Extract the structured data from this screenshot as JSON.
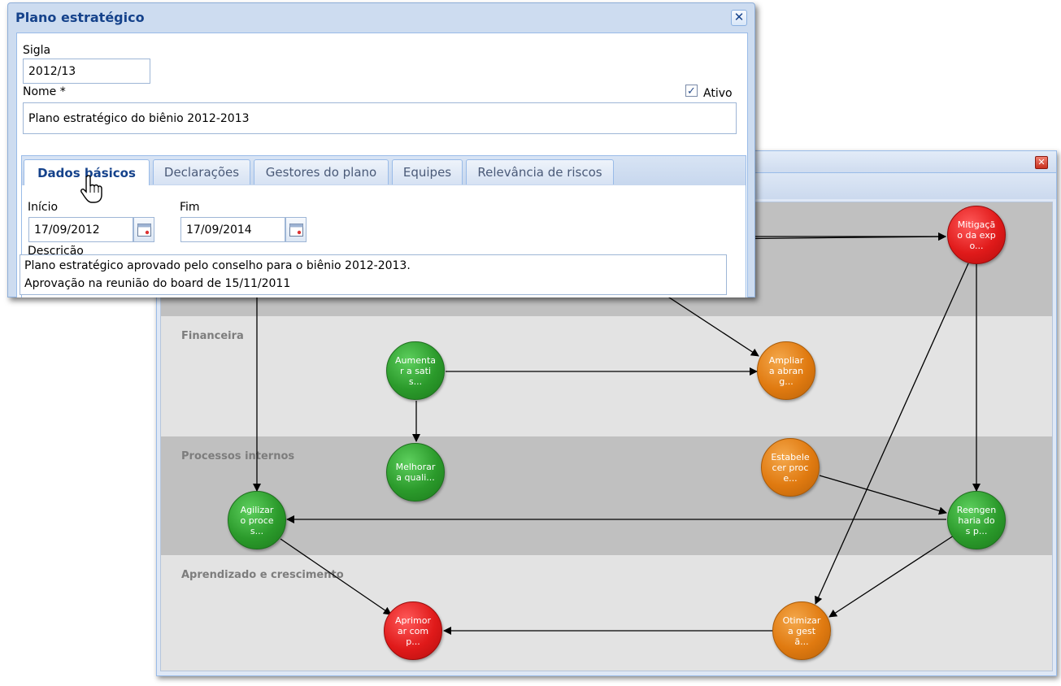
{
  "dialog": {
    "title": "Plano estratégico",
    "sigla_label": "Sigla",
    "sigla_value": "2012/13",
    "nome_label": "Nome *",
    "nome_value": "Plano estratégico do biênio 2012-2013",
    "ativo_label": "Ativo",
    "ativo_checked": true,
    "tabs": [
      {
        "label": "Dados básicos",
        "active": true
      },
      {
        "label": "Declarações",
        "active": false
      },
      {
        "label": "Gestores do plano",
        "active": false
      },
      {
        "label": "Equipes",
        "active": false
      },
      {
        "label": "Relevância de riscos",
        "active": false
      }
    ],
    "inicio_label": "Início",
    "inicio_value": "17/09/2012",
    "fim_label": "Fim",
    "fim_value": "17/09/2014",
    "descricao_label": "Descrição",
    "descricao_lines": [
      "Plano estratégico aprovado pelo conselho para o biênio 2012-2013.",
      "Aprovação na reunião do board de 15/11/2011"
    ]
  },
  "map": {
    "bands": [
      {
        "label": ""
      },
      {
        "label": "Financeira"
      },
      {
        "label": "Processos internos"
      },
      {
        "label": "Aprendizado e crescimento"
      }
    ],
    "nodes": [
      {
        "id": "mitigacao",
        "text": "Mitigação da expo...",
        "color": "red"
      },
      {
        "id": "aumentar",
        "text": "Aumentar a satis...",
        "color": "green"
      },
      {
        "id": "ampliar",
        "text": "Ampliar a abrang...",
        "color": "orange"
      },
      {
        "id": "melhorar",
        "text": "Melhorar a quali...",
        "color": "green"
      },
      {
        "id": "estabelecer",
        "text": "Estabelecer proce...",
        "color": "orange"
      },
      {
        "id": "agilizar",
        "text": "Agilizar o proces...",
        "color": "green"
      },
      {
        "id": "reengenharia",
        "text": "Reengenharia dos p...",
        "color": "green"
      },
      {
        "id": "aprimorar",
        "text": "Aprimorar comp...",
        "color": "red"
      },
      {
        "id": "otimizar",
        "text": "Otimizar a gestã...",
        "color": "orange"
      }
    ],
    "colors": {
      "green": "#2b9a2b",
      "orange": "#e07a10",
      "red": "#e01a1a",
      "band_dark": "#c0c0c0",
      "band_light": "#e3e3e3"
    }
  }
}
